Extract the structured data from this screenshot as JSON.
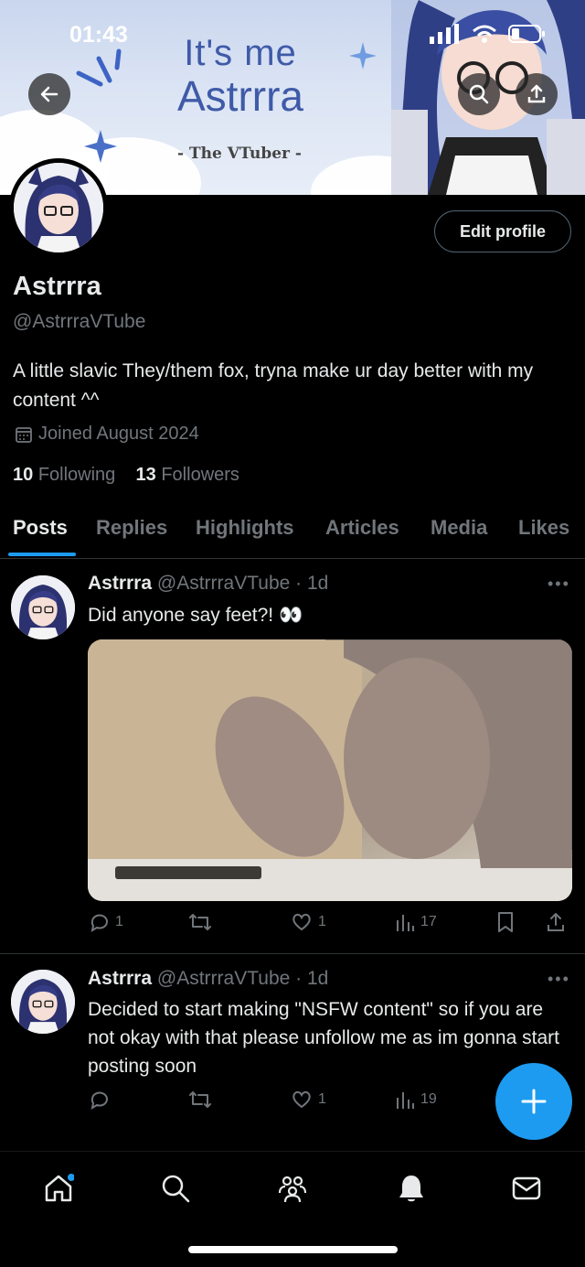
{
  "status_bar": {
    "time": "01:43"
  },
  "banner": {
    "title_line1": "It's me",
    "title_line2": "Astrrra",
    "subtitle": "- The VTuber -"
  },
  "profile": {
    "edit_label": "Edit profile",
    "name": "Astrrra",
    "handle": "@AstrrraVTube",
    "bio": "A little slavic They/them fox, tryna make ur day better with my content ^^",
    "joined": "Joined August 2024",
    "following_count": "10",
    "following_label": "Following",
    "followers_count": "13",
    "followers_label": "Followers"
  },
  "tabs": [
    "Posts",
    "Replies",
    "Highlights",
    "Articles",
    "Media",
    "Likes"
  ],
  "posts": [
    {
      "name": "Astrrra",
      "handle": "@AstrrraVTube",
      "time": "· 1d",
      "text": "Did anyone say feet?! 👀",
      "replies": "1",
      "reposts": "",
      "likes": "1",
      "views": "17"
    },
    {
      "name": "Astrrra",
      "handle": "@AstrrraVTube",
      "time": "· 1d",
      "text": "Decided to start making \"NSFW content\" so if you are not okay with that please unfollow me as im gonna start posting soon",
      "replies": "",
      "reposts": "",
      "likes": "1",
      "views": "19"
    }
  ],
  "colors": {
    "accent": "#1d9bf0",
    "muted": "#71767b",
    "text": "#e7e9ea",
    "divider": "#2f3336"
  }
}
